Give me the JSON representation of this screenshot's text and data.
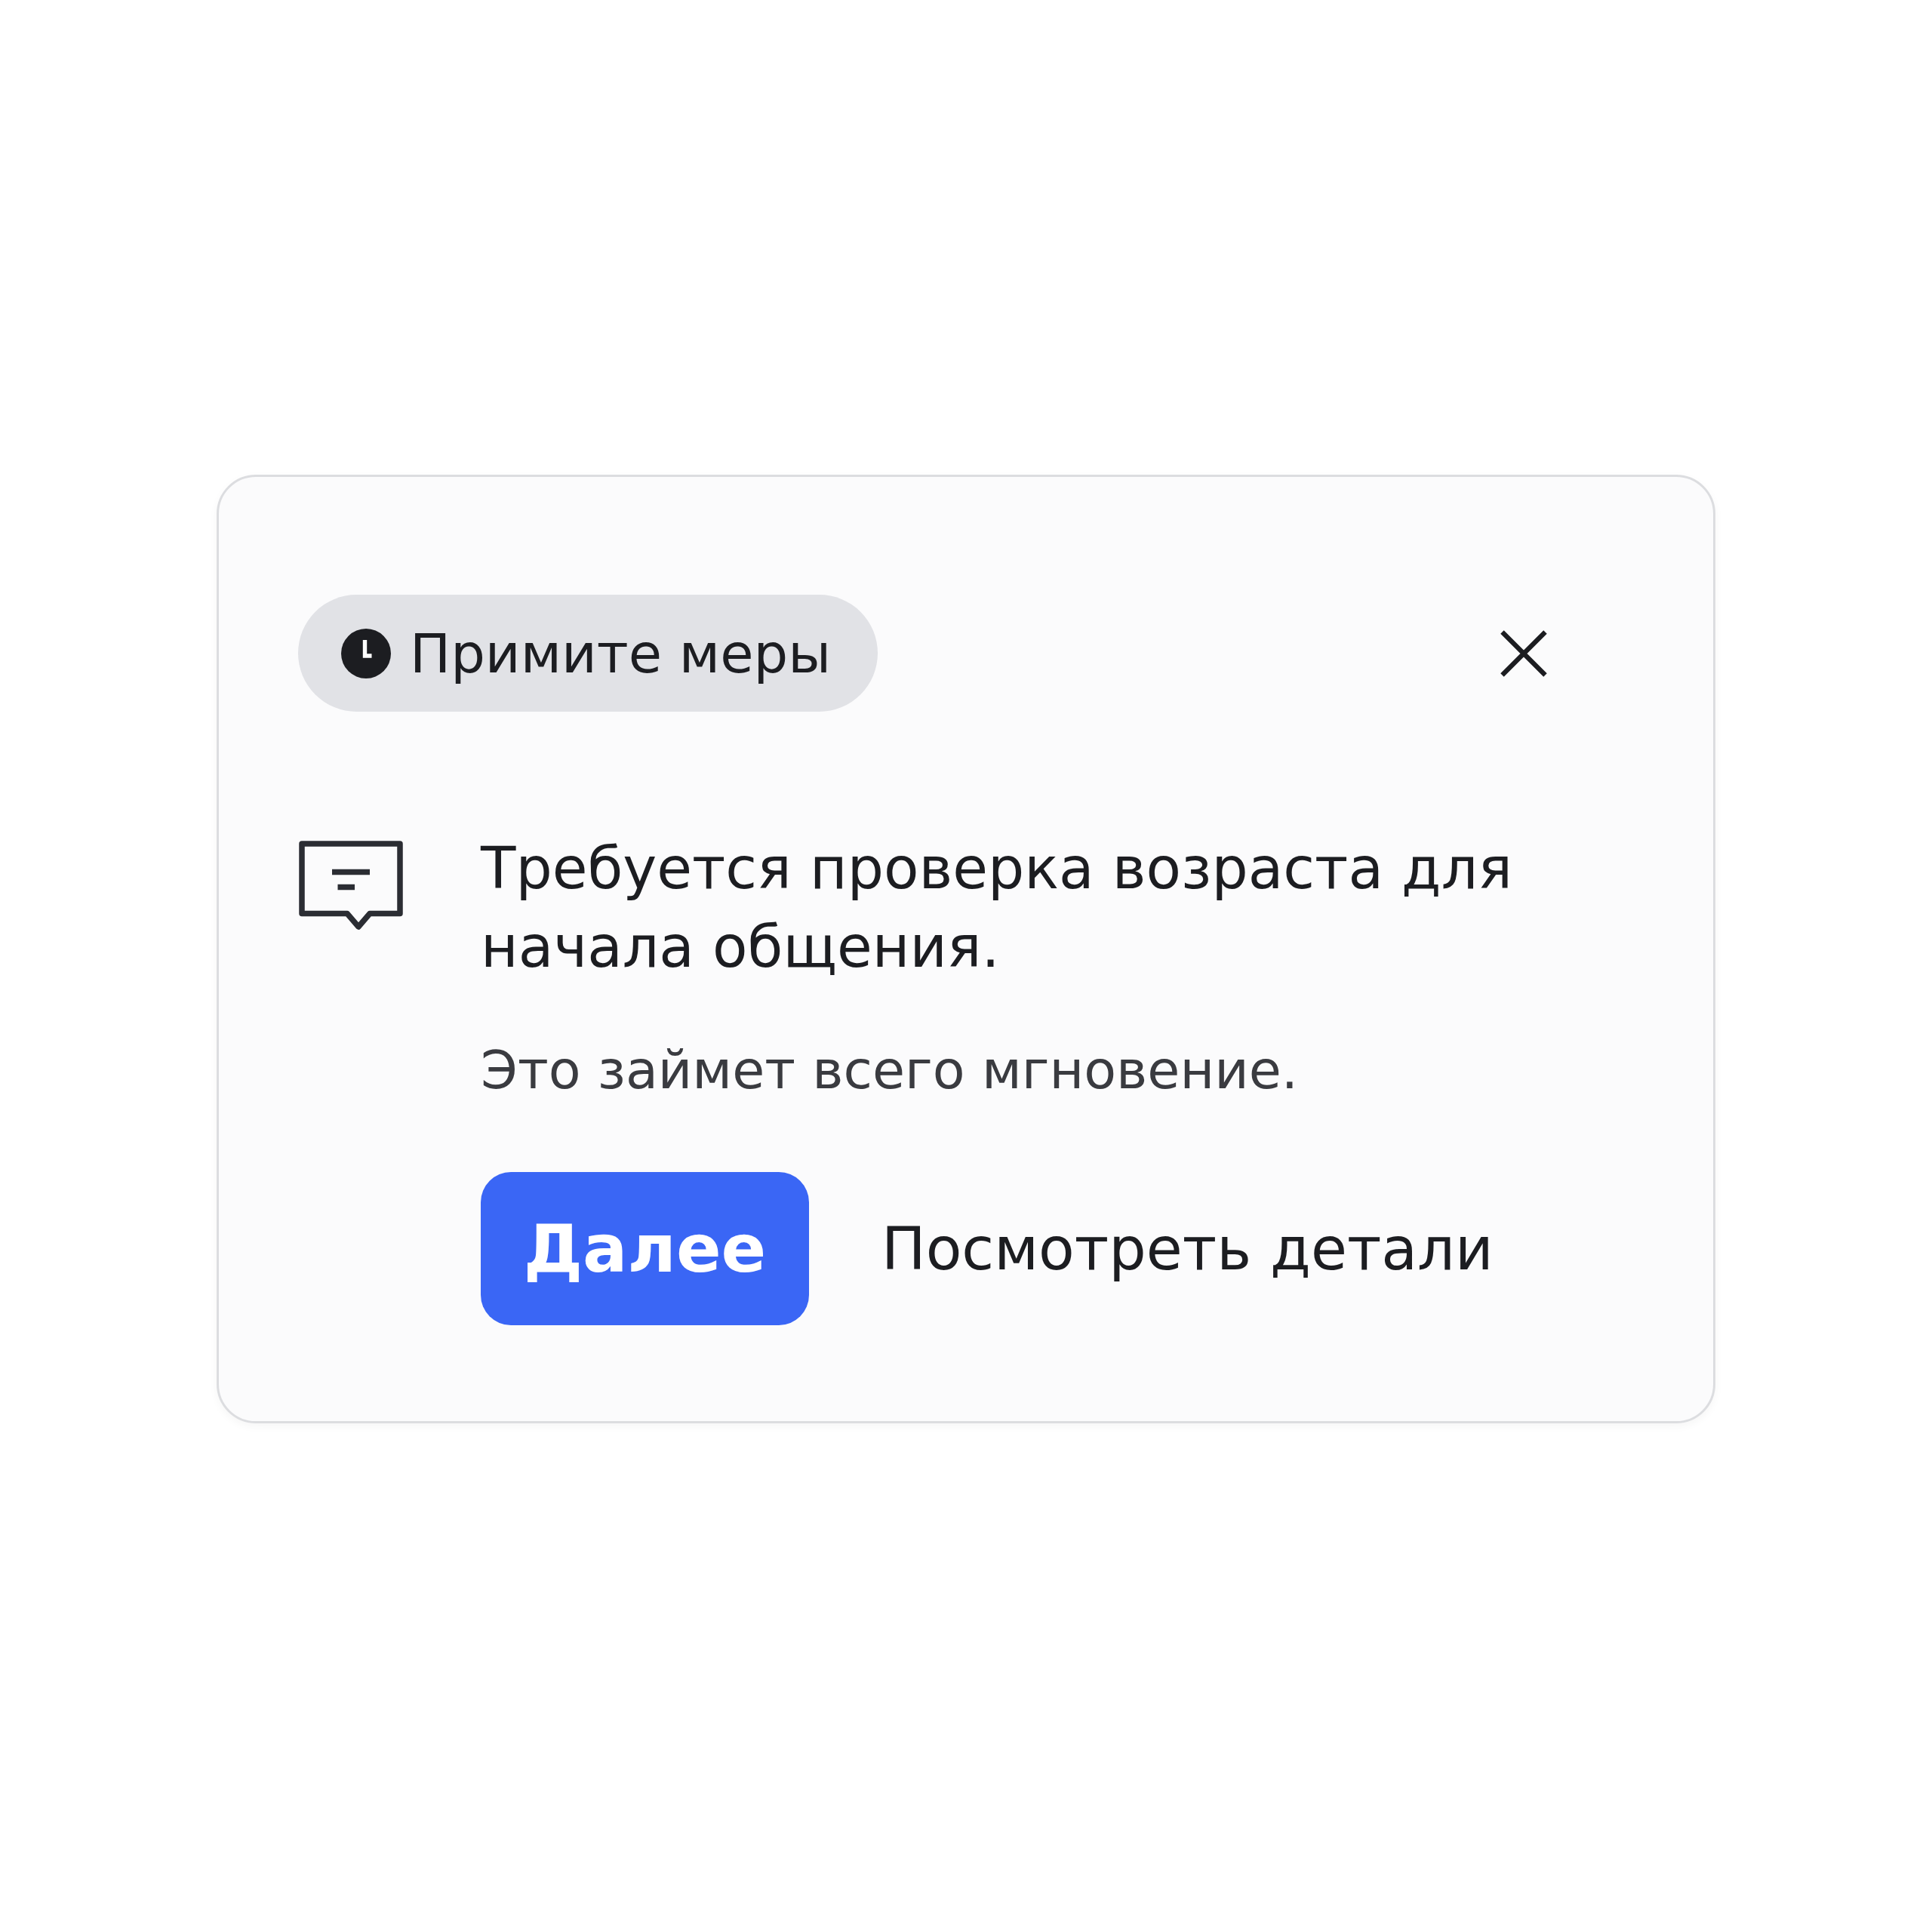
{
  "badge": {
    "label": "Примите меры"
  },
  "message": {
    "title": "Требуется проверка возраста для начала общения.",
    "subtitle": "Это займет всего мгновение."
  },
  "actions": {
    "primary": "Далее",
    "secondary": "Посмотреть детали"
  }
}
